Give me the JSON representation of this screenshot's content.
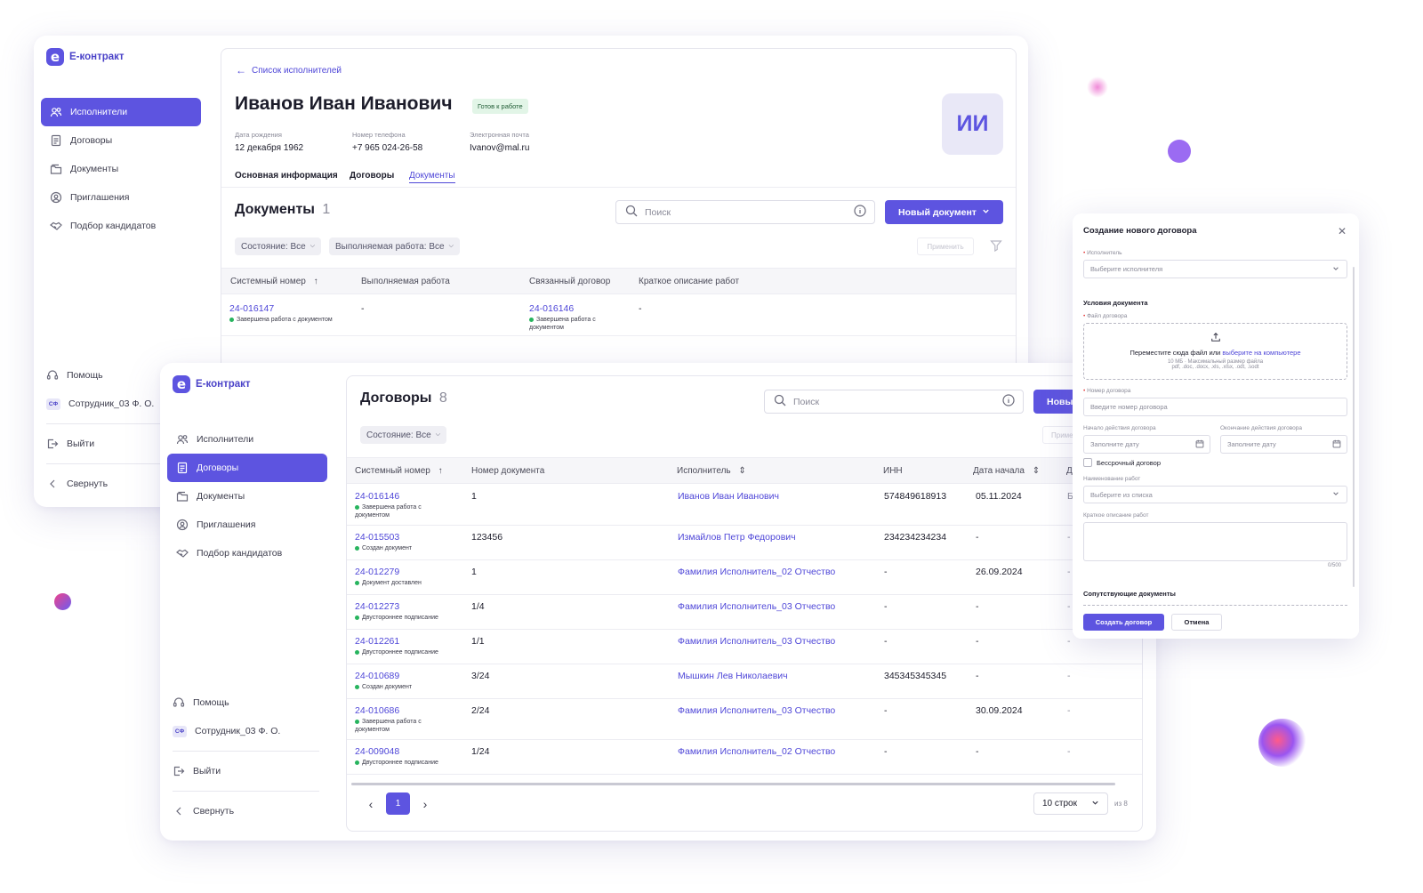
{
  "brand": "E-контракт",
  "brand_mark": "e",
  "colors": {
    "accent": "#5d54e0",
    "link": "#4f47d8",
    "status_green": "#27b45e"
  },
  "nav": [
    {
      "label": "Исполнители",
      "icon": "users-icon"
    },
    {
      "label": "Договоры",
      "icon": "contract-icon"
    },
    {
      "label": "Документы",
      "icon": "documents-icon"
    },
    {
      "label": "Приглашения",
      "icon": "invitation-icon"
    },
    {
      "label": "Подбор кандидатов",
      "icon": "handshake-icon"
    }
  ],
  "bottom_nav": {
    "help": "Помощь",
    "user_initials": "СФ",
    "user": "Сотрудник_03 Ф. О.",
    "logout": "Выйти",
    "collapse": "Свернуть"
  },
  "back": {
    "profile": {
      "breadcrumb": "Список исполнителей",
      "name": "Иванов Иван Иванович",
      "badge": "Готов к работе",
      "avatar": "ИИ",
      "birth_label": "Дата рождения",
      "birth_value": "12 декабря 1962",
      "phone_label": "Номер телефона",
      "phone_value": "+7 965 024-26-58",
      "email_label": "Электронная почта",
      "email_value": "Ivanov@mal.ru",
      "tabs": [
        "Основная информация",
        "Договоры",
        "Документы"
      ]
    },
    "docs": {
      "title": "Документы",
      "count": "1",
      "search_placeholder": "Поиск",
      "new_button": "Новый документ",
      "filters": [
        "Состояние: Все",
        "Выполняемая работа: Все"
      ],
      "apply": "Применить",
      "headers": [
        "Системный номер",
        "Выполняемая работа",
        "Связанный договор",
        "Краткое описание работ"
      ],
      "row": {
        "number": "24-016147",
        "status": "Завершена работа с документом",
        "work": "-",
        "contract": "24-016146",
        "contract_status": "Завершена работа с документом",
        "desc": "-"
      }
    }
  },
  "front": {
    "title": "Договоры",
    "count": "8",
    "search_placeholder": "Поиск",
    "new_button": "Новы",
    "filter": "Состояние: Все",
    "apply": "Приме",
    "headers": [
      "Системный номер",
      "Номер документа",
      "Исполнитель",
      "ИНН",
      "Дата начала",
      "Д"
    ],
    "rows": [
      {
        "number": "24-016146",
        "status": "Завершена работа с документом",
        "doc": "1",
        "executor": "Иванов Иван Иванович",
        "inn": "574849618913",
        "start": "05.11.2024",
        "end": "Б"
      },
      {
        "number": "24-015503",
        "status": "Создан документ",
        "doc": "123456",
        "executor": "Измайлов Петр Федорович",
        "inn": "234234234234",
        "start": "-",
        "end": "-"
      },
      {
        "number": "24-012279",
        "status": "Документ доставлен",
        "doc": "1",
        "executor": "Фамилия Исполнитель_02 Отчество",
        "inn": "-",
        "start": "26.09.2024",
        "end": "-"
      },
      {
        "number": "24-012273",
        "status": "Двустороннее подписание",
        "doc": "1/4",
        "executor": "Фамилия Исполнитель_03 Отчество",
        "inn": "-",
        "start": "-",
        "end": "-"
      },
      {
        "number": "24-012261",
        "status": "Двустороннее подписание",
        "doc": "1/1",
        "executor": "Фамилия Исполнитель_03 Отчество",
        "inn": "-",
        "start": "-",
        "end": "-"
      },
      {
        "number": "24-010689",
        "status": "Создан документ",
        "doc": "3/24",
        "executor": "Мышкин Лев Николаевич",
        "inn": "345345345345",
        "start": "-",
        "end": "-"
      },
      {
        "number": "24-010686",
        "status": "Завершена работа с документом",
        "doc": "2/24",
        "executor": "Фамилия Исполнитель_03 Отчество",
        "inn": "-",
        "start": "30.09.2024",
        "end": "-"
      },
      {
        "number": "24-009048",
        "status": "Двустороннее подписание",
        "doc": "1/24",
        "executor": "Фамилия Исполнитель_02 Отчество",
        "inn": "-",
        "start": "-",
        "end": "-"
      }
    ],
    "pagination": {
      "page": "1",
      "rows_per_page": "10 строк",
      "total": "из 8"
    }
  },
  "modal": {
    "title": "Создание нового договора",
    "executor_label": "Исполнитель",
    "executor_placeholder": "Выберите исполнителя",
    "conditions": "Условия документа",
    "file_label": "Файл договора",
    "drop_text": "Переместите сюда файл или",
    "drop_link": "выберите на компьютере",
    "drop_hint1": "10 МБ · Максимальный размер файла",
    "drop_hint2": "pdf, .doc, .docx, .xls, .xlsx, .odt, .sodt",
    "number_label": "Номер договора",
    "number_placeholder": "Введите номер договора",
    "start_label": "Начало действия договора",
    "end_label": "Окончание действия договора",
    "date_placeholder": "Заполните дату",
    "indefinite": "Бессрочный договор",
    "work_label": "Наименование работ",
    "work_placeholder": "Выберите из списка",
    "desc_label": "Краткое описание работ",
    "counter": "0/500",
    "related": "Сопутствующие документы",
    "create": "Создать договор",
    "cancel": "Отмена"
  }
}
